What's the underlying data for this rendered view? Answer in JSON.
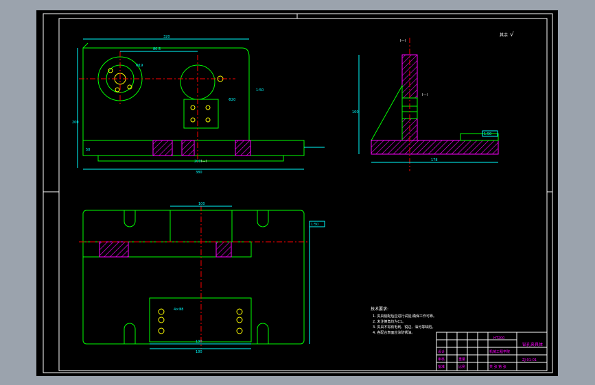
{
  "drawing": {
    "roughness_label": "其余",
    "roughness_symbol": "√",
    "section_label": "I—I",
    "front_dims": {
      "overall_width": "320",
      "top_offset": "80.5",
      "height_left": "200",
      "small_left": "50",
      "center_dim": "200",
      "base_len": "380",
      "callout_a": "Φ19",
      "callout_b": "Φ20",
      "note_right": "1:50",
      "section_mark": "I—I"
    },
    "side_dims": {
      "height": "100",
      "span": "178",
      "flat_label": "1:50",
      "tag": "I—I"
    },
    "plan_dims": {
      "top_span": "100",
      "lower_span": "130",
      "bottom_span": "180",
      "flat_tag": "1:50",
      "hole_note": "4×Φ8"
    },
    "tech_notes": {
      "heading": "技术要求:",
      "lines": [
        "1. 夹具装配后应进行试验,确保工作可靠。",
        "2. 未注倒角均为C1。",
        "3. 夹具不得有毛刺、锐边、油污等缺陷。",
        "4. 各配合表面应涂防锈油。"
      ]
    },
    "title_block": {
      "material": "HT200",
      "name": "钻孔夹具体",
      "drawing_no": "ZJ-01-01",
      "school": "机械工程学院",
      "row_design": "设计",
      "row_check": "审核",
      "row_approve": "批准",
      "scale_label": "比例",
      "sheet_label": "共 张 第 张",
      "weight_label": "重量"
    }
  },
  "colors": {
    "background": "#000000",
    "outline": "#00ff00",
    "dimension": "#00ffff",
    "centerline": "#ff0000",
    "hatch": "#ff00ff",
    "frame": "#ffffff",
    "text_yellow": "#ffff00"
  }
}
